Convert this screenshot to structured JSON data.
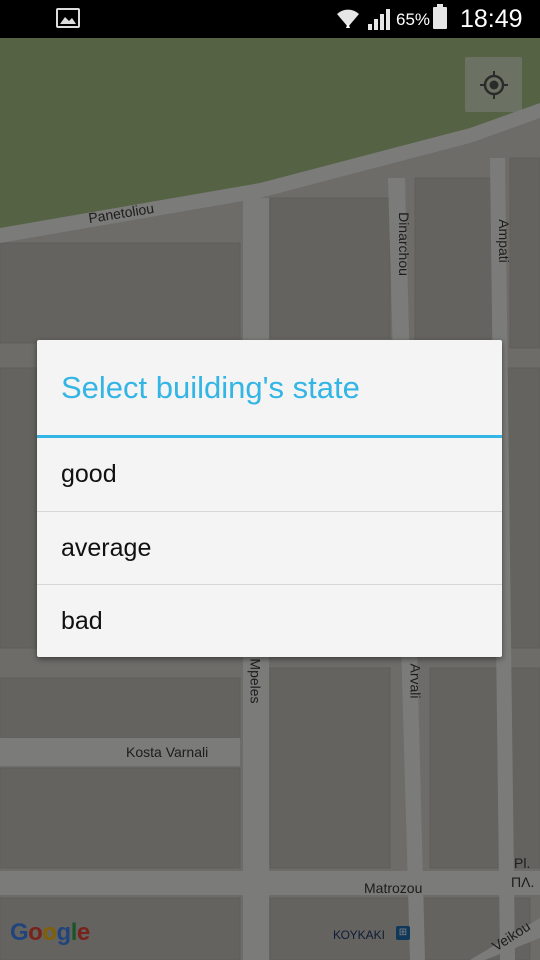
{
  "status_bar": {
    "battery_percent": "65%",
    "time": "18:49",
    "icons": [
      "gallery-icon",
      "wifi-icon",
      "signal-icon",
      "battery-icon"
    ]
  },
  "map": {
    "streets": {
      "panetoliou": "Panetoliou",
      "dinarchou": "Dinarchou",
      "ampati": "Ampati",
      "mpeles": "Mpeles",
      "arvali": "Arvali",
      "kosta_varnali": "Kosta Varnali",
      "matrozou": "Matrozou",
      "veikou": "Veikou",
      "pl": "Pl.",
      "pl_greek": "ΠΛ."
    },
    "district": "ΚΟΥΚΑΚΙ",
    "logo": "Google",
    "colors": {
      "park": "#a7c086",
      "ground": "#d7d4cf",
      "buildings": "#c6c2bb",
      "roads": "#f2f1ee"
    }
  },
  "dialog": {
    "title": "Select building's state",
    "options": [
      {
        "label": "good"
      },
      {
        "label": "average"
      },
      {
        "label": "bad"
      }
    ],
    "accent_color": "#33b5e5"
  }
}
